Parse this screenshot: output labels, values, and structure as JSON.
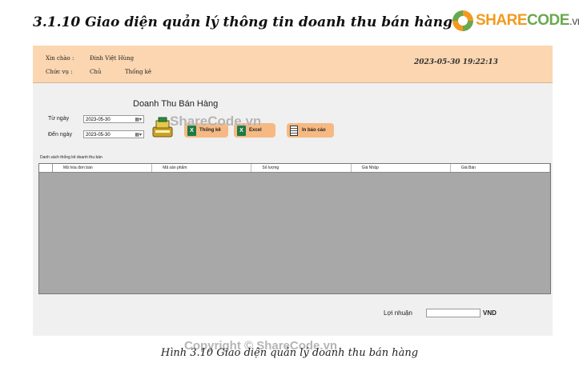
{
  "heading": "3.1.10 Giao diện quản lý thông tin doanh thu bán hàng",
  "logo": {
    "part1": "SHARE",
    "part2": "CODE",
    "part3": ".vn"
  },
  "app": {
    "header": {
      "greeting_label": "Xin chào :",
      "user_name": "Đinh Việt Hùng",
      "role_label": "Chức vụ :",
      "role_value": "Chủ",
      "stats_link": "Thống kê",
      "timestamp": "2023-05-30 19:22:13"
    },
    "title": "Doanh Thu Bán Hàng",
    "from_label": "Từ ngày",
    "from_value": "2023-05-30",
    "to_label": "Đến ngày",
    "to_value": "2023-05-30",
    "buttons": {
      "stats": "Thống kê",
      "excel": "Excel",
      "print": "In báo cáo"
    },
    "section_label": "Danh sách thống kê doanh thu bán",
    "columns": [
      "Mã hóa đơn bán",
      "Mã sản phẩm",
      "Số lượng",
      "Giá Nhập",
      "Giá Bán"
    ],
    "profit_label": "Lợi nhuận",
    "profit_value": "",
    "unit": "VND"
  },
  "watermarks": {
    "center": "ShareCode.vn",
    "bottom": "Copyright © ShareCode.vn"
  },
  "caption": "Hình 3.10 Giao diện quản lý doanh thu bán hàng"
}
